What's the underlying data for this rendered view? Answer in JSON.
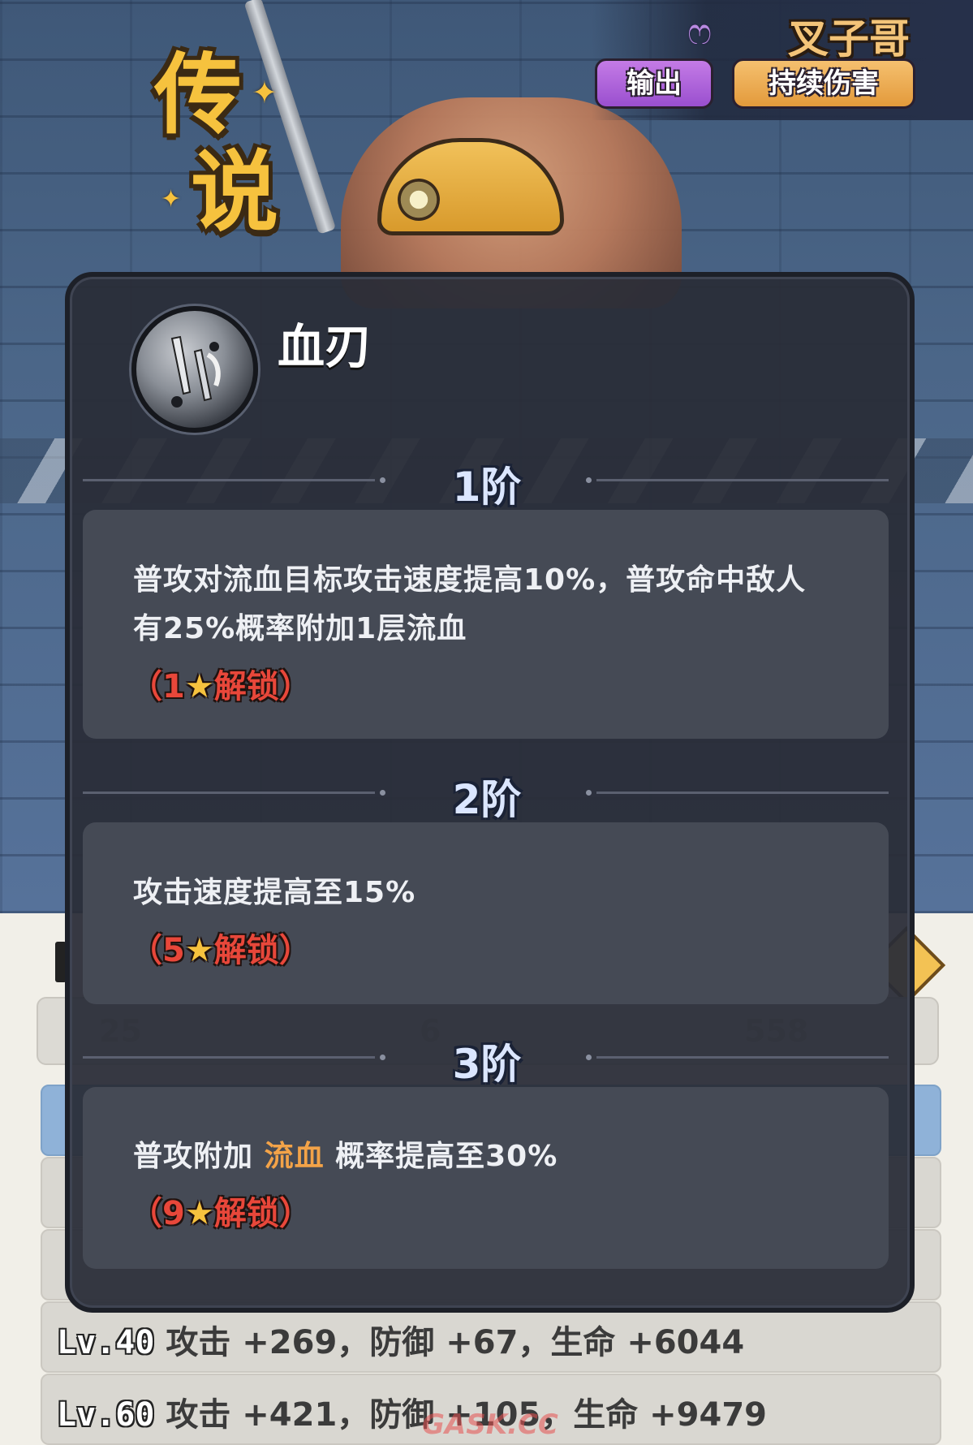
{
  "hero": {
    "rarity_chars": [
      "传",
      "说"
    ],
    "name": "叉子哥",
    "tags": [
      "输出",
      "持续伤害"
    ]
  },
  "popup": {
    "skill_name": "血刃",
    "tiers": [
      {
        "title": "1阶",
        "desc_line1": "普攻对流血目标攻击速度提高10%，普攻命中敌人",
        "desc_line2": "有25%概率附加1层流血",
        "unlock_open": "（",
        "unlock_stars": "1",
        "unlock_text": "解锁",
        "unlock_close": "）"
      },
      {
        "title": "2阶",
        "desc_line1": "攻击速度提高至15%",
        "unlock_open": "（",
        "unlock_stars": "5",
        "unlock_text": "解锁",
        "unlock_close": "）"
      },
      {
        "title": "3阶",
        "desc_prefix": "普攻附加",
        "desc_keyword": "流血",
        "desc_suffix": "概率提高至30%",
        "unlock_open": "（",
        "unlock_stars": "9",
        "unlock_text": "解锁",
        "unlock_close": "）"
      }
    ]
  },
  "stats": {
    "summary": [
      "25",
      "6",
      "558"
    ],
    "levels": [
      {
        "lv": "Lv.40",
        "text": "攻击 +269，防御 +67，生命 +6044"
      },
      {
        "lv": "Lv.60",
        "text": "攻击 +421，防御 +105，生命 +9479"
      }
    ]
  },
  "watermark": "GASK.CC",
  "colors": {
    "unlock_red": "#e8473a",
    "keyword_orange": "#f3a348",
    "gold": "#f6c23e"
  }
}
